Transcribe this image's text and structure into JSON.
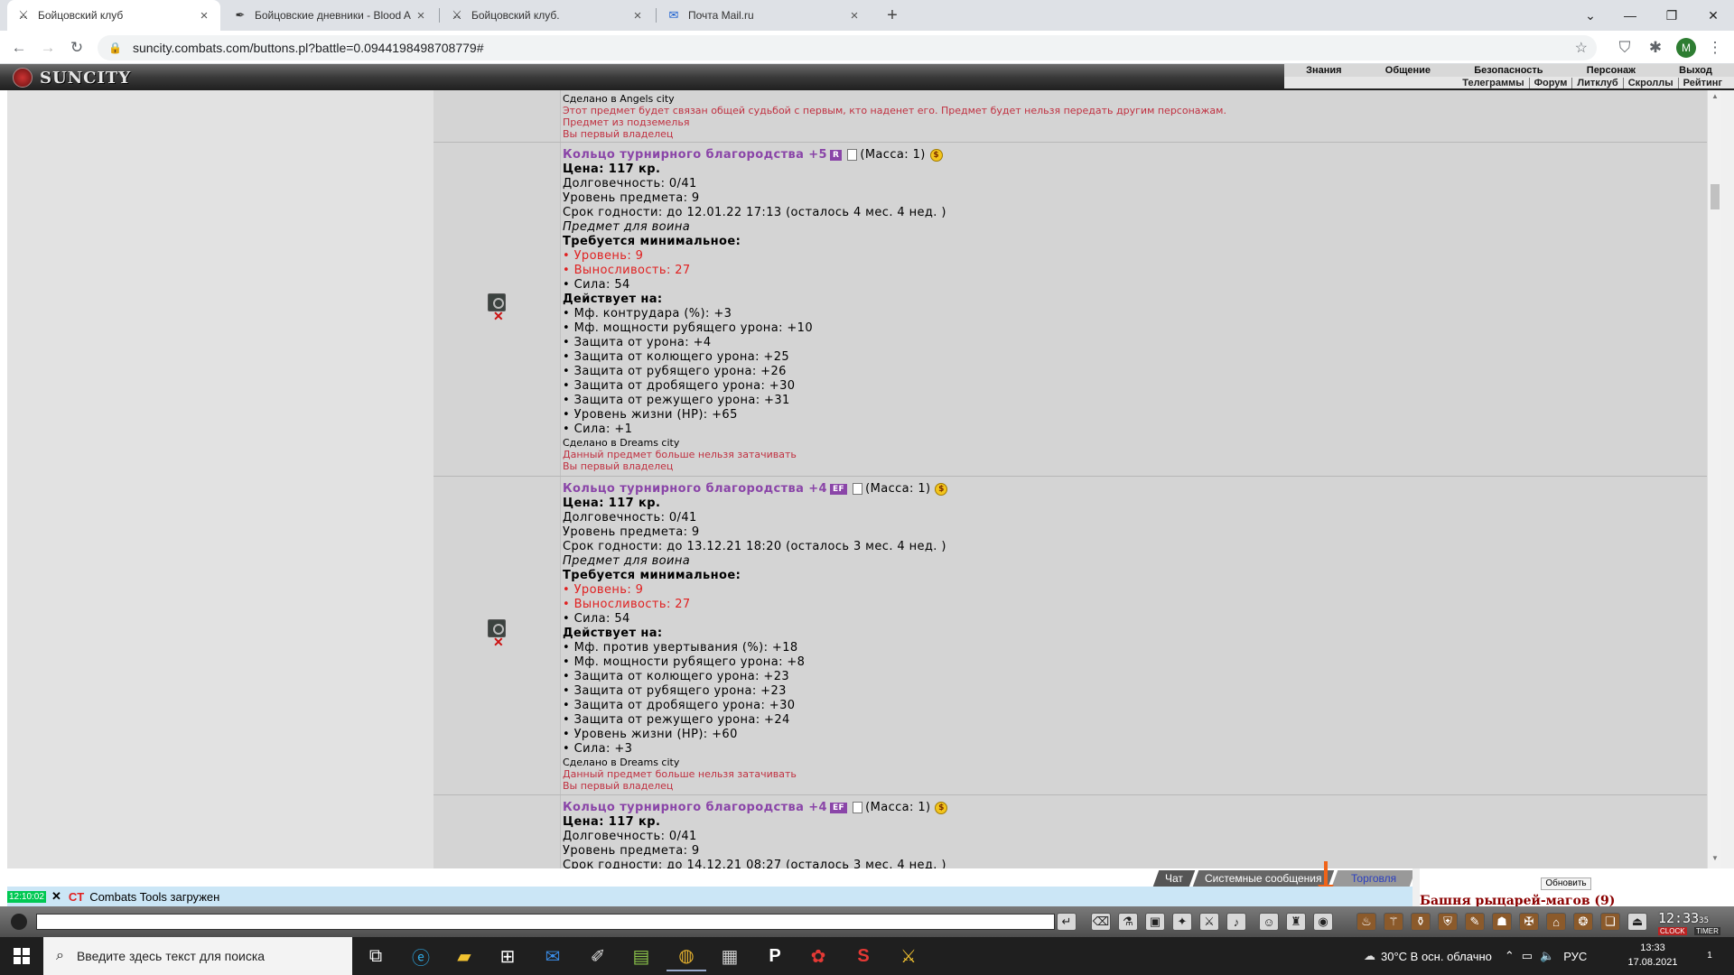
{
  "browser": {
    "tabs": [
      {
        "label": "Бойцовский клуб",
        "icon": "combats-swords-icon",
        "active": true
      },
      {
        "label": "Бойцовские дневники - Blood A",
        "icon": "feather-icon",
        "active": false
      },
      {
        "label": "Бойцовский клуб.",
        "icon": "combats-swords-icon",
        "active": false
      },
      {
        "label": "Почта Mail.ru",
        "icon": "mail-icon",
        "active": false
      }
    ],
    "new_tab": "+",
    "url": "suncity.combats.com/buttons.pl?battle=0.0944198498708779#",
    "profile_initial": "M"
  },
  "game_header": {
    "logo": "SUNCITY",
    "menu": [
      "Знания",
      "Общение",
      "Безопасность",
      "Персонаж",
      "Выход"
    ],
    "submenu": [
      "Телеграммы",
      "Форум",
      "Литклуб",
      "Скроллы",
      "Рейтинг"
    ]
  },
  "items": [
    {
      "partial": true,
      "made_in": "Сделано в Angels city",
      "notes": [
        "Этот предмет будет связан общей судьбой с первым, кто наденет его. Предмет будет нельзя передать другим персонажам.",
        "Предмет из подземелья",
        "Вы первый владелец"
      ]
    },
    {
      "name": "Кольцо турнирного благородства +5",
      "badge": "R",
      "mass": "(Масса: 1)",
      "price": "Цена: 117 кр.",
      "durability": "Долговечность: 0/41",
      "level": "Уровень предмета: 9",
      "expiry": "Срок годности: до 12.01.22 17:13 (осталось 4 мес. 4 нед. )",
      "for_class": "Предмет для воина",
      "req_title": "Требуется минимальное:",
      "requirements": [
        {
          "text": "Уровень: 9",
          "unmet": true
        },
        {
          "text": "Выносливость: 27",
          "unmet": true
        },
        {
          "text": "Сила: 54",
          "unmet": false
        }
      ],
      "effects_title": "Действует на:",
      "effects": [
        "Мф. контрудара (%): +3",
        "Мф. мощности рубящего урона: +10",
        "Защита от урона: +4",
        "Защита от колющего урона: +25",
        "Защита от рубящего урона: +26",
        "Защита от дробящего урона: +30",
        "Защита от режущего урона: +31",
        "Уровень жизни (HP): +65",
        "Сила: +1"
      ],
      "made_in": "Сделано в Dreams city",
      "notes": [
        "Данный предмет больше нельзя затачивать",
        "Вы первый владелец"
      ]
    },
    {
      "name": "Кольцо турнирного благородства +4",
      "badge": "EF",
      "mass": "(Масса: 1)",
      "price": "Цена: 117 кр.",
      "durability": "Долговечность: 0/41",
      "level": "Уровень предмета: 9",
      "expiry": "Срок годности: до 13.12.21 18:20 (осталось 3 мес. 4 нед. )",
      "for_class": "Предмет для воина",
      "req_title": "Требуется минимальное:",
      "requirements": [
        {
          "text": "Уровень: 9",
          "unmet": true
        },
        {
          "text": "Выносливость: 27",
          "unmet": true
        },
        {
          "text": "Сила: 54",
          "unmet": false
        }
      ],
      "effects_title": "Действует на:",
      "effects": [
        "Мф. против увертывания (%): +18",
        "Мф. мощности рубящего урона: +8",
        "Защита от колющего урона: +23",
        "Защита от рубящего урона: +23",
        "Защита от дробящего урона: +30",
        "Защита от режущего урона: +24",
        "Уровень жизни (HP): +60",
        "Сила: +3"
      ],
      "made_in": "Сделано в Dreams city",
      "notes": [
        "Данный предмет больше нельзя затачивать",
        "Вы первый владелец"
      ]
    },
    {
      "name": "Кольцо турнирного благородства +4",
      "badge": "EF",
      "mass": "(Масса: 1)",
      "price": "Цена: 117 кр.",
      "durability": "Долговечность: 0/41",
      "level": "Уровень предмета: 9",
      "expiry": "Срок годности: до 14.12.21 08:27 (осталось 3 мес. 4 нед. )"
    }
  ],
  "chat": {
    "tabs": [
      "Чат",
      "Системные сообщения",
      "Торговля"
    ],
    "message_time": "12:10:02",
    "message_prefix": "CT",
    "message_text": "Combats Tools загружен",
    "refresh_label": "Обновить",
    "location": "Башня рыцарей-магов (9)"
  },
  "game_clock": {
    "time": "12:33",
    "seconds": "35",
    "label_left": "CLOCK",
    "label_right": "TIMER"
  },
  "taskbar": {
    "search_placeholder": "Введите здесь текст для поиска",
    "weather": "30°C  В осн. облачно",
    "lang": "РУС",
    "time": "13:33",
    "date": "17.08.2021",
    "notifications": "1"
  }
}
